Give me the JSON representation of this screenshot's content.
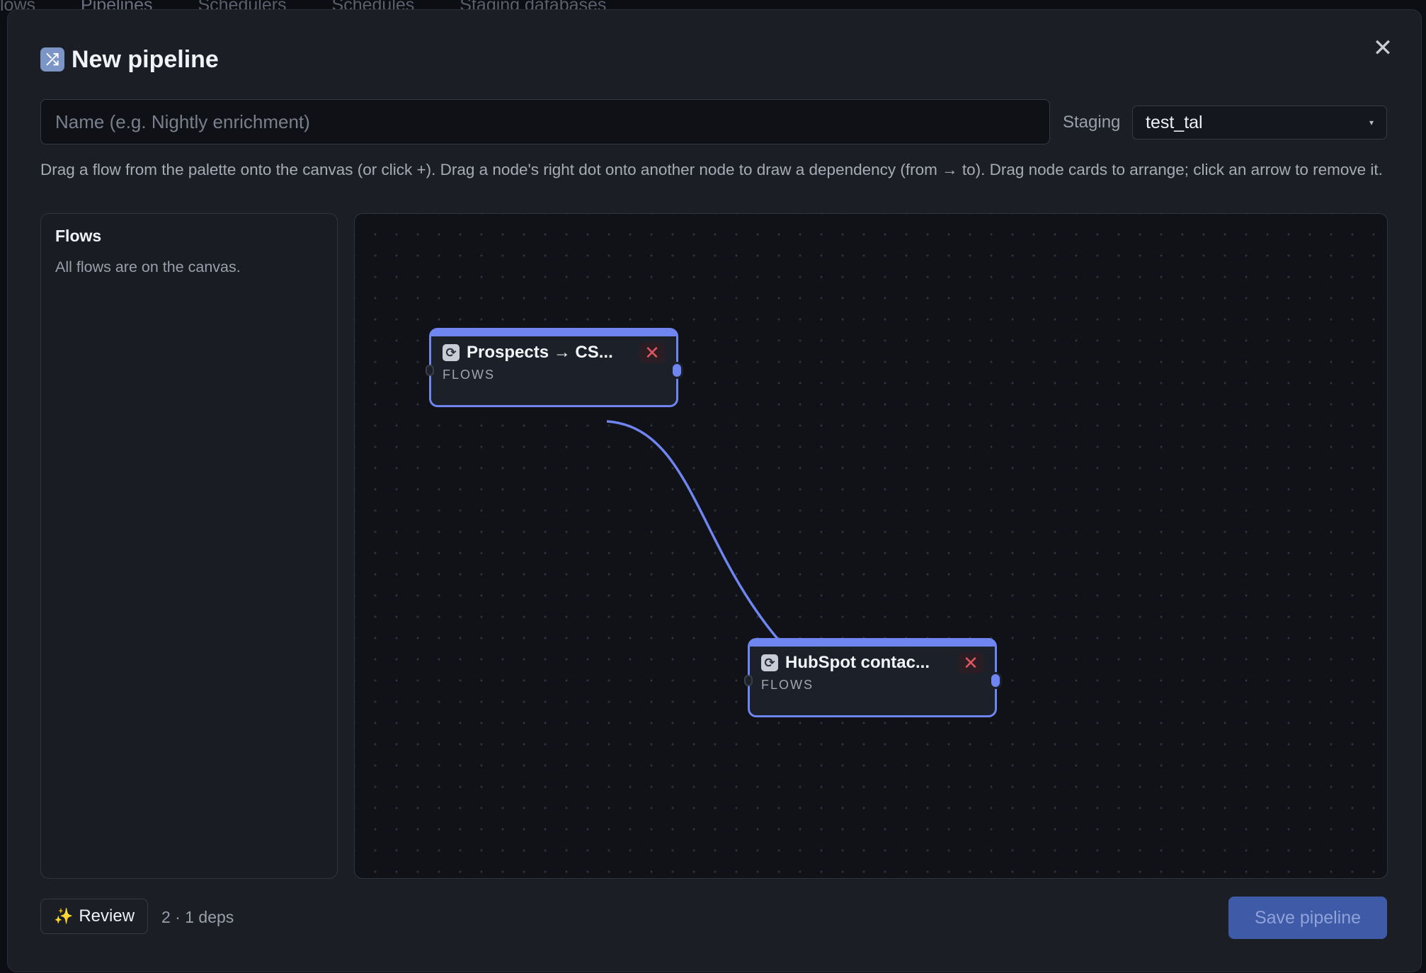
{
  "background_tabs": [
    "lows",
    "Pipelines",
    "Schedulers",
    "Schedules",
    "Staging databases"
  ],
  "modal": {
    "title": "New pipeline",
    "title_icon": "shuffle-icon",
    "close_icon": "close-icon",
    "name_placeholder": "Name (e.g. Nightly enrichment)",
    "name_value": "",
    "staging_label": "Staging",
    "staging_value": "test_tal",
    "help_text": "Drag a flow from the palette onto the canvas (or click +). Drag a node's right dot onto another node to draw a dependency (from → to). Drag node cards to arrange; click an arrow to remove it."
  },
  "palette": {
    "title": "Flows",
    "empty_message": "All flows are on the canvas."
  },
  "canvas": {
    "nodes": [
      {
        "name": "Prospects → CS...",
        "kind": "FLOWS",
        "icon": "refresh-icon"
      },
      {
        "name": "HubSpot contac...",
        "kind": "FLOWS",
        "icon": "refresh-icon"
      }
    ],
    "edges": [
      {
        "from": "Prospects → CS...",
        "to": "HubSpot contac..."
      }
    ],
    "accent_color": "#6f86f0"
  },
  "footer": {
    "review_label": "Review",
    "review_icon": "sparkles-icon",
    "deps_summary": "2 · 1 deps",
    "save_label": "Save pipeline"
  }
}
